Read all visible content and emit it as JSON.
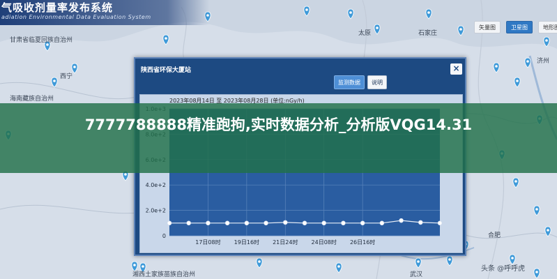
{
  "header": {
    "title": "气吸收剂量率发布系统",
    "subtitle": "adiation Environmental Data Evaluation System"
  },
  "map_tabs": [
    {
      "label": "矢量图",
      "active": false
    },
    {
      "label": "卫星图",
      "active": true
    },
    {
      "label": "地形图",
      "active": false
    }
  ],
  "map_labels": [
    {
      "text": "甘肃省临夏回族自治州"
    },
    {
      "text": "西宁"
    },
    {
      "text": "海南藏族自治州"
    },
    {
      "text": "太原"
    },
    {
      "text": "石家庄"
    },
    {
      "text": "济州"
    },
    {
      "text": "合肥"
    },
    {
      "text": "武汉"
    },
    {
      "text": "湘西土家族苗族自治州"
    }
  ],
  "dialog": {
    "title": "陕西省环保大厦站",
    "close_glyph": "×",
    "monitor_button": "监测数据",
    "explain_button": "说明",
    "caption": "2023年08月14日 至 2023年08月28日 (单位:nGy/h)"
  },
  "chart_data": {
    "type": "line",
    "title": "2023年08月14日 至 2023年08月28日 (单位:nGy/h)",
    "xlabel": "",
    "ylabel": "",
    "y_tick_labels": [
      "0",
      "2.0e+2",
      "4.0e+2",
      "6.0e+2",
      "8.0e+2",
      "1.0e+3"
    ],
    "y_ticks": [
      0,
      200,
      400,
      600,
      800,
      1000
    ],
    "ylim": [
      0,
      1000
    ],
    "x_tick_labels": [
      "17日08时",
      "19日16时",
      "21日24时",
      "24日08时",
      "26日16时"
    ],
    "x_tick_positions": [
      2,
      4,
      6,
      8,
      10
    ],
    "xlim": [
      0,
      14
    ],
    "grid": true,
    "series": [
      {
        "x": [
          0,
          1,
          2,
          3,
          4,
          5,
          6,
          7,
          8,
          9,
          10,
          11,
          12,
          13,
          14
        ],
        "values": [
          100,
          100,
          100,
          100,
          100,
          100,
          105,
          100,
          100,
          100,
          100,
          100,
          120,
          105,
          100
        ],
        "color": "#e8eef7"
      }
    ]
  },
  "banner": {
    "text": "7777788888精准跑拘,实时数据分析_分析版VQG14.31"
  },
  "watermark": "头条 @呼呼虎"
}
